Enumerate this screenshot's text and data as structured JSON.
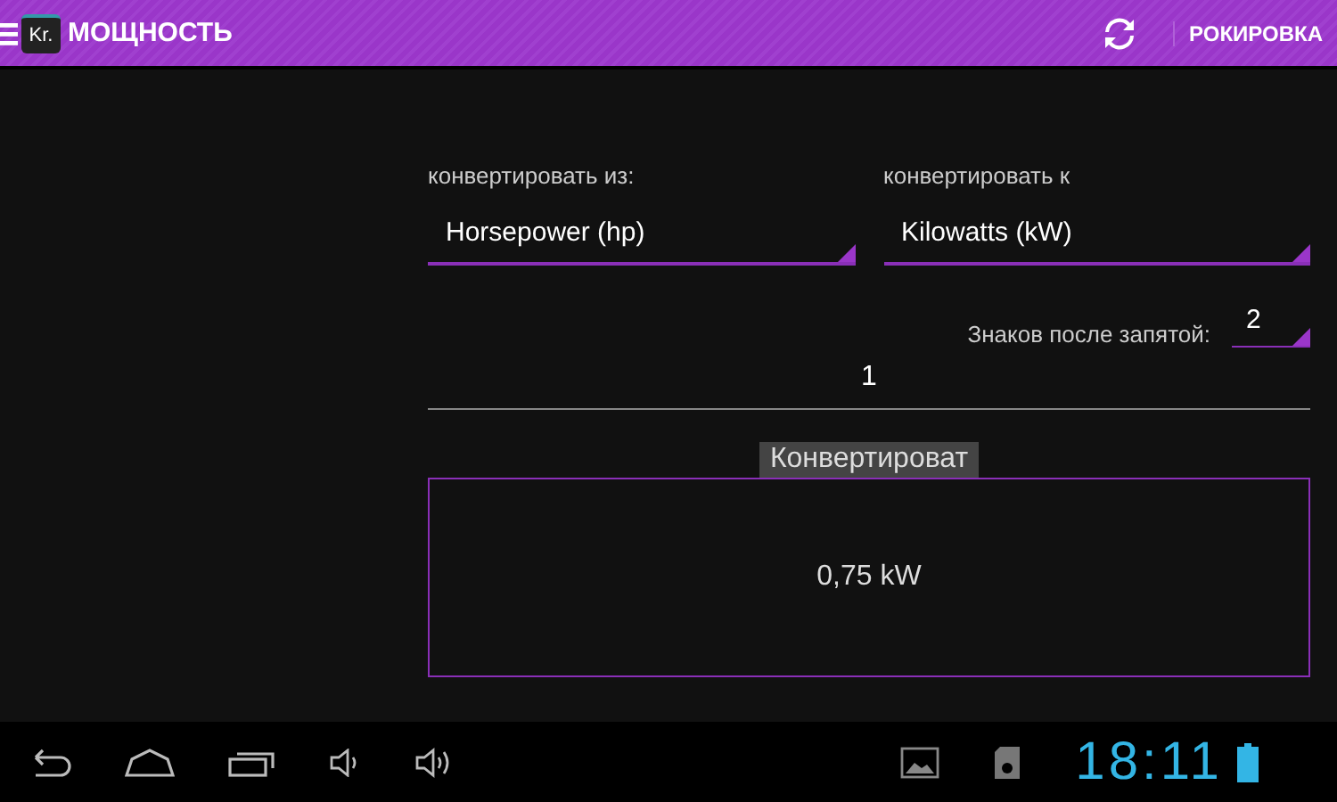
{
  "action_bar": {
    "title": "МОЩНОСТЬ",
    "app_icon_text": "Kr.",
    "action": "РОКИРОВКА"
  },
  "from": {
    "label": "конвертировать из:",
    "value": "Horsepower (hp)"
  },
  "to": {
    "label": "конвертировать к",
    "value": "Kilowatts (kW)"
  },
  "decimals": {
    "label": "Знаков после запятой:",
    "value": "2"
  },
  "input": {
    "value": "1"
  },
  "convert_button": "Конвертироват",
  "result": "0,75 kW",
  "status_bar": {
    "time": "18:11"
  }
}
